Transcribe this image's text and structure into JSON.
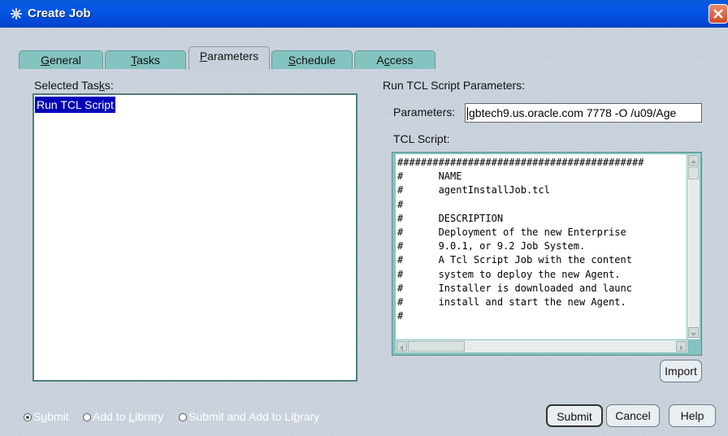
{
  "window": {
    "title": "Create Job"
  },
  "tabs": [
    {
      "label": "General",
      "mnemonic": "G",
      "rest": "eneral"
    },
    {
      "label": "Tasks",
      "mnemonic": "T",
      "rest": "asks"
    },
    {
      "label": "Parameters",
      "mnemonic": "P",
      "rest": "arameters",
      "active": true
    },
    {
      "label": "Schedule",
      "mnemonic": "S",
      "rest": "chedule"
    },
    {
      "label": "Access",
      "mnemonic": "A",
      "pre": "A",
      "mid": "c",
      "post": "cess"
    }
  ],
  "selected_tasks": {
    "label_pre": "Selected Tas",
    "label_mnemonic": "k",
    "label_post": "s:",
    "items": [
      "Run TCL Script"
    ]
  },
  "run_params": {
    "section_label": "Run TCL Script Parameters:",
    "parameters_label": "Parameters:",
    "parameters_value": "gbtech9.us.oracle.com 7778 -O /u09/Age",
    "script_label": "TCL Script:",
    "script_lines": [
      "##########################################",
      "#      NAME",
      "#      agentInstallJob.tcl",
      "#",
      "#      DESCRIPTION",
      "#      Deployment of the new Enterprise",
      "#      9.0.1, or 9.2 Job System.",
      "#      A Tcl Script Job with the content",
      "#      system to deploy the new Agent.",
      "#      Installer is downloaded and launc",
      "#      install and start the new Agent.",
      "#"
    ],
    "import_label": "Import"
  },
  "footer": {
    "radios": [
      {
        "pre": "S",
        "mn": "u",
        "post": "bmit",
        "selected": true
      },
      {
        "pre": "Add to ",
        "mn": "L",
        "post": "ibrary",
        "selected": false
      },
      {
        "pre": "Submit and Add to Li",
        "mn": "b",
        "post": "rary",
        "selected": false
      }
    ],
    "submit_label": "Submit",
    "cancel_label": "Cancel",
    "help_label": "Help"
  },
  "colors": {
    "titlebar": "#0356e6",
    "tab": "#84c4c0",
    "selection": "#0000b8"
  }
}
